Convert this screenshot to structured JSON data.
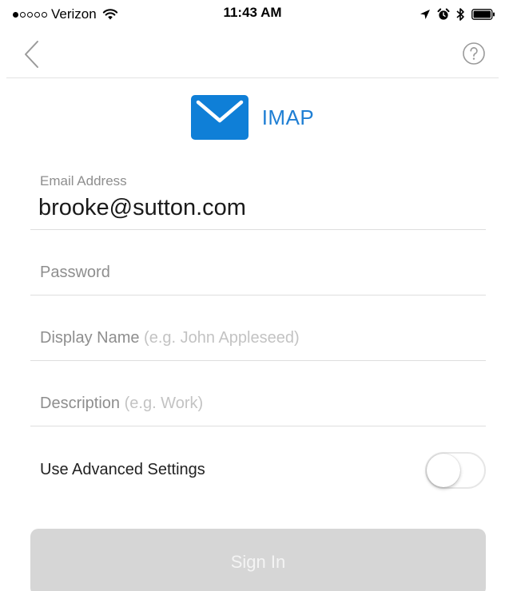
{
  "status_bar": {
    "carrier": "Verizon",
    "time": "11:43 AM",
    "signal_bars_filled": 1,
    "signal_bars_total": 5,
    "icons": [
      "wifi-icon",
      "location-arrow-icon",
      "alarm-icon",
      "bluetooth-icon",
      "battery-icon"
    ]
  },
  "nav": {
    "back_icon": "chevron-left-icon",
    "help_icon": "question-circle-icon"
  },
  "provider": {
    "name": "IMAP",
    "icon": "envelope-icon",
    "accent_color": "#0f7fd7"
  },
  "form": {
    "email": {
      "label": "Email Address",
      "value": "brooke@sutton.com"
    },
    "password": {
      "label": "Password"
    },
    "display_name": {
      "label": "Display Name",
      "hint": "(e.g. John Appleseed)"
    },
    "description": {
      "label": "Description",
      "hint": "(e.g. Work)"
    },
    "advanced": {
      "label": "Use Advanced Settings",
      "enabled": false
    }
  },
  "actions": {
    "sign_in_label": "Sign In",
    "sign_in_enabled": false
  }
}
